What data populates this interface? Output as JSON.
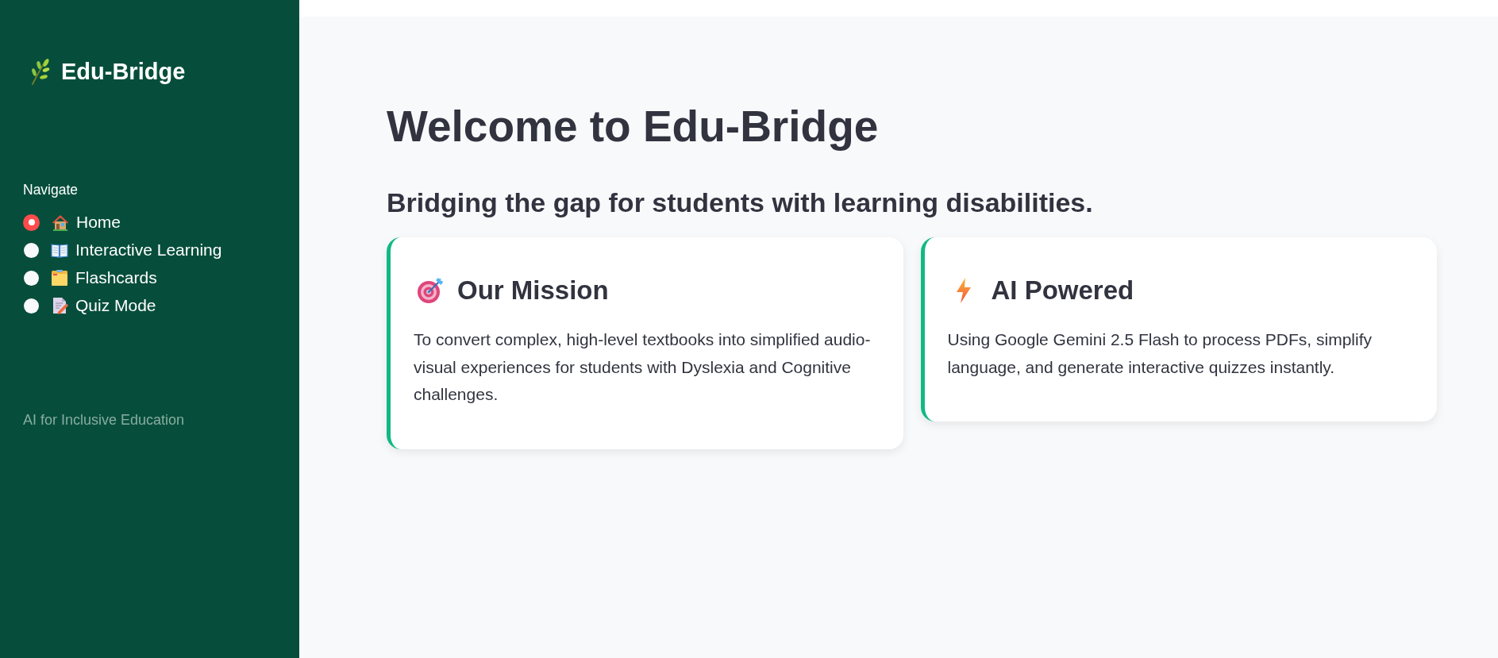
{
  "sidebar": {
    "title": "Edu-Bridge",
    "nav_label": "Navigate",
    "nav_items": [
      {
        "label": "Home",
        "selected": true
      },
      {
        "label": "Interactive Learning",
        "selected": false
      },
      {
        "label": "Flashcards",
        "selected": false
      },
      {
        "label": "Quiz Mode",
        "selected": false
      }
    ],
    "footer": "AI for Inclusive Education"
  },
  "main": {
    "title": "Welcome to Edu-Bridge",
    "subtitle": "Bridging the gap for students with learning disabilities.",
    "cards": [
      {
        "title": "Our Mission",
        "text": "To convert complex, high-level textbooks into simplified audio-visual experiences for students with Dyslexia and Cognitive challenges."
      },
      {
        "title": "AI Powered",
        "text": "Using Google Gemini 2.5 Flash to process PDFs, simplify language, and generate interactive quizzes instantly."
      }
    ]
  }
}
